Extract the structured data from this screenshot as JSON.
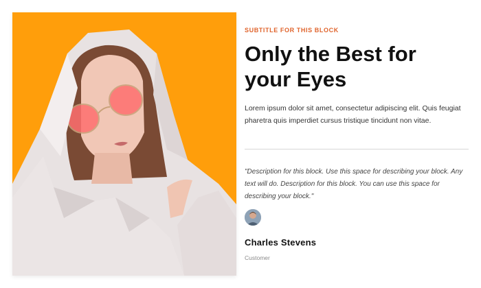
{
  "block": {
    "subtitle": "SUBTITLE FOR THIS BLOCK",
    "title": "Only the Best for your Eyes",
    "body": "Lorem ipsum dolor sit amet, consectetur adipiscing elit. Quis feugiat pharetra quis imperdiet cursus tristique tincidunt non vitae."
  },
  "testimonial": {
    "quote": "\"Description for this block. Use this space for describing your block. Any text will do. Description for this block. You can use this space for describing your block.\"",
    "author_name": "Charles Stevens",
    "author_role": "Customer"
  },
  "colors": {
    "accent": "#e0632b",
    "hero_background": "#ff9e0b",
    "title": "#111111"
  }
}
